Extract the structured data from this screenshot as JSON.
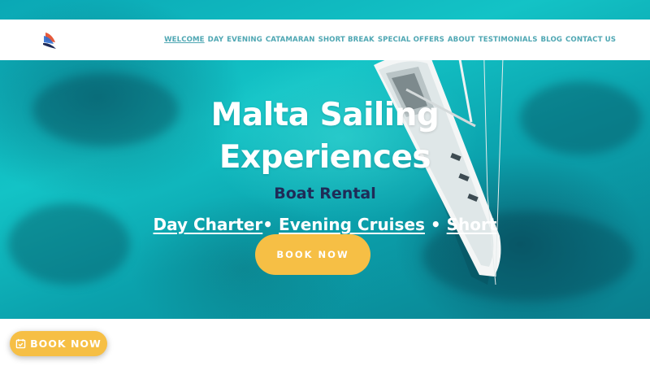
{
  "header": {
    "logo_icon": "sail-logo-icon",
    "nav": [
      {
        "label": "WELCOME",
        "active": true
      },
      {
        "label": "DAY",
        "active": false
      },
      {
        "label": "EVENING",
        "active": false
      },
      {
        "label": "CATAMARAN",
        "active": false
      },
      {
        "label": "SHORT BREAK",
        "active": false
      },
      {
        "label": "SPECIAL OFFERS",
        "active": false
      },
      {
        "label": "ABOUT",
        "active": false
      },
      {
        "label": "TESTIMONIALS",
        "active": false
      },
      {
        "label": "BLOG",
        "active": false
      },
      {
        "label": "CONTACT US",
        "active": false
      }
    ]
  },
  "hero": {
    "title_line1": "Malta Sailing",
    "title_line2": "Experiences",
    "subtitle": "Boat Rental",
    "services": [
      {
        "label": "Day Charter"
      },
      {
        "label": "Evening Cruises"
      },
      {
        "label": "Short Breaks"
      }
    ],
    "separator": "•",
    "book_label": "BOOK NOW"
  },
  "floating": {
    "book_label": "BOOK NOW",
    "icon": "calendar-check-icon"
  },
  "colors": {
    "accent": "#f6bf45",
    "nav_text": "#4fa7b3",
    "subtitle": "#1f2b57",
    "sea": "#13c3c6"
  }
}
